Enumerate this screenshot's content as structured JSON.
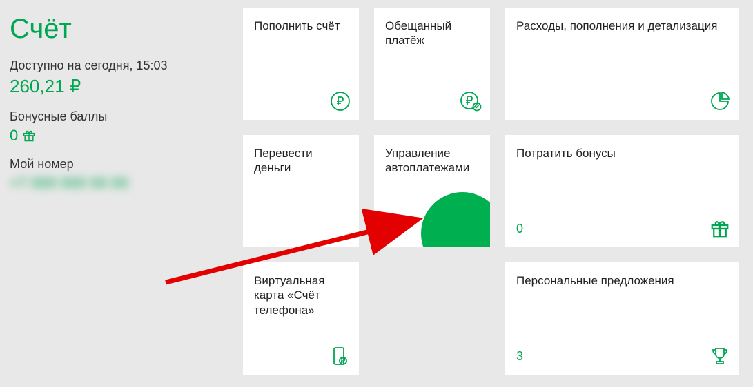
{
  "sidebar": {
    "title": "Счёт",
    "available_label": "Доступно на сегодня, 15:03",
    "balance": "260,21 ₽",
    "bonus_label": "Бонусные баллы",
    "bonus_value": "0",
    "phone_label": "Мой номер",
    "phone_number": "+7 000 000 00 00"
  },
  "cards": {
    "topup": {
      "title": "Пополнить счёт"
    },
    "promised": {
      "title": "Обещанный платёж"
    },
    "expenses": {
      "title": "Расходы, пополнения и детализация"
    },
    "transfer": {
      "title": "Перевести деньги"
    },
    "autopay": {
      "title": "Управление автоплатежами"
    },
    "spendbonus": {
      "title": "Потратить бонусы",
      "value": "0"
    },
    "virtualcard": {
      "title": "Виртуальная карта «Счёт телефона»"
    },
    "offers": {
      "title": "Персональные предложения",
      "value": "3"
    }
  }
}
